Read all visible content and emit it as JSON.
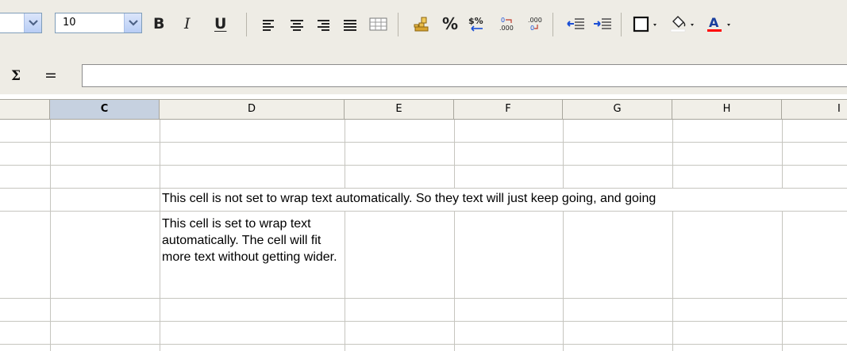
{
  "toolbar": {
    "font_name_value": "",
    "font_size_value": "10",
    "bold_label": "B",
    "italic_label": "I",
    "underline_label": "U",
    "percent_label": "%",
    "currency_label": "$%"
  },
  "formula_bar": {
    "sigma_label": "Σ",
    "equals_label": "=",
    "input_value": ""
  },
  "sheet": {
    "columns": [
      "C",
      "D",
      "E",
      "F",
      "G",
      "H",
      "I"
    ],
    "selected_column": "C"
  },
  "cells": {
    "overflow_text": "This cell is not set to wrap text automatically. So they text will just keep going, and going",
    "wrap_text": "This cell is set to wrap text automatically. The cell will fit more text without getting wider."
  },
  "icons": [
    "bold-icon",
    "italic-icon",
    "underline-icon",
    "align-left-icon",
    "align-center-icon",
    "align-right-icon",
    "justify-icon",
    "merge-cells-icon",
    "currency-icon",
    "percent-icon",
    "standard-format-icon",
    "add-decimal-icon",
    "remove-decimal-icon",
    "decrease-indent-icon",
    "increase-indent-icon",
    "borders-icon",
    "background-color-icon",
    "font-color-icon"
  ],
  "colors": {
    "toolbar_bg": "#eeece5",
    "selected_column_bg": "#c6d1e0",
    "font_color_bar": "#ff0000",
    "indent_arrow": "#1a4fd6"
  }
}
